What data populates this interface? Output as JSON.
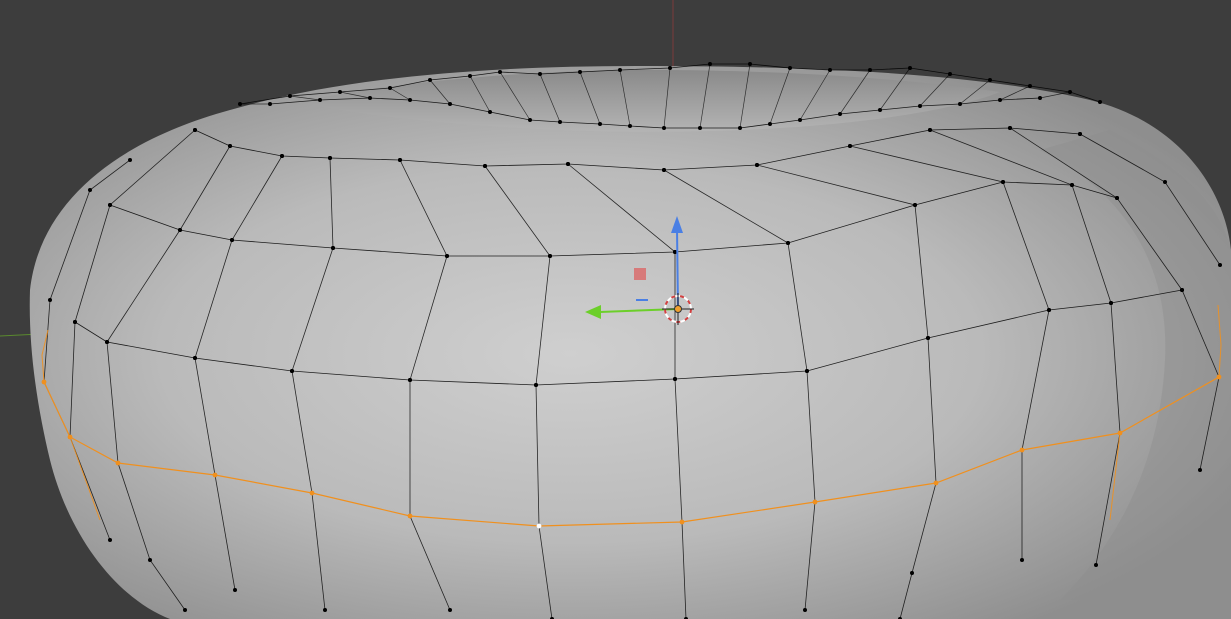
{
  "viewport": {
    "mode": "edit-mode-mesh",
    "object": "torus",
    "background_color": "#3d3d3d",
    "surface_color": "#b9b9b9",
    "wire_color": "#000000",
    "selected_color": "#f0901e",
    "active_vertex_color": "#ffffff",
    "axis_colors": {
      "x": "#c84b4b",
      "y": "#6ccf2a",
      "z": "#4a7fe4"
    },
    "icons": [
      "3d-cursor-icon",
      "transform-gizmo-z-arrow-icon",
      "transform-gizmo-y-arrow-icon",
      "transform-gizmo-x-handle-icon",
      "object-origin-icon"
    ]
  }
}
